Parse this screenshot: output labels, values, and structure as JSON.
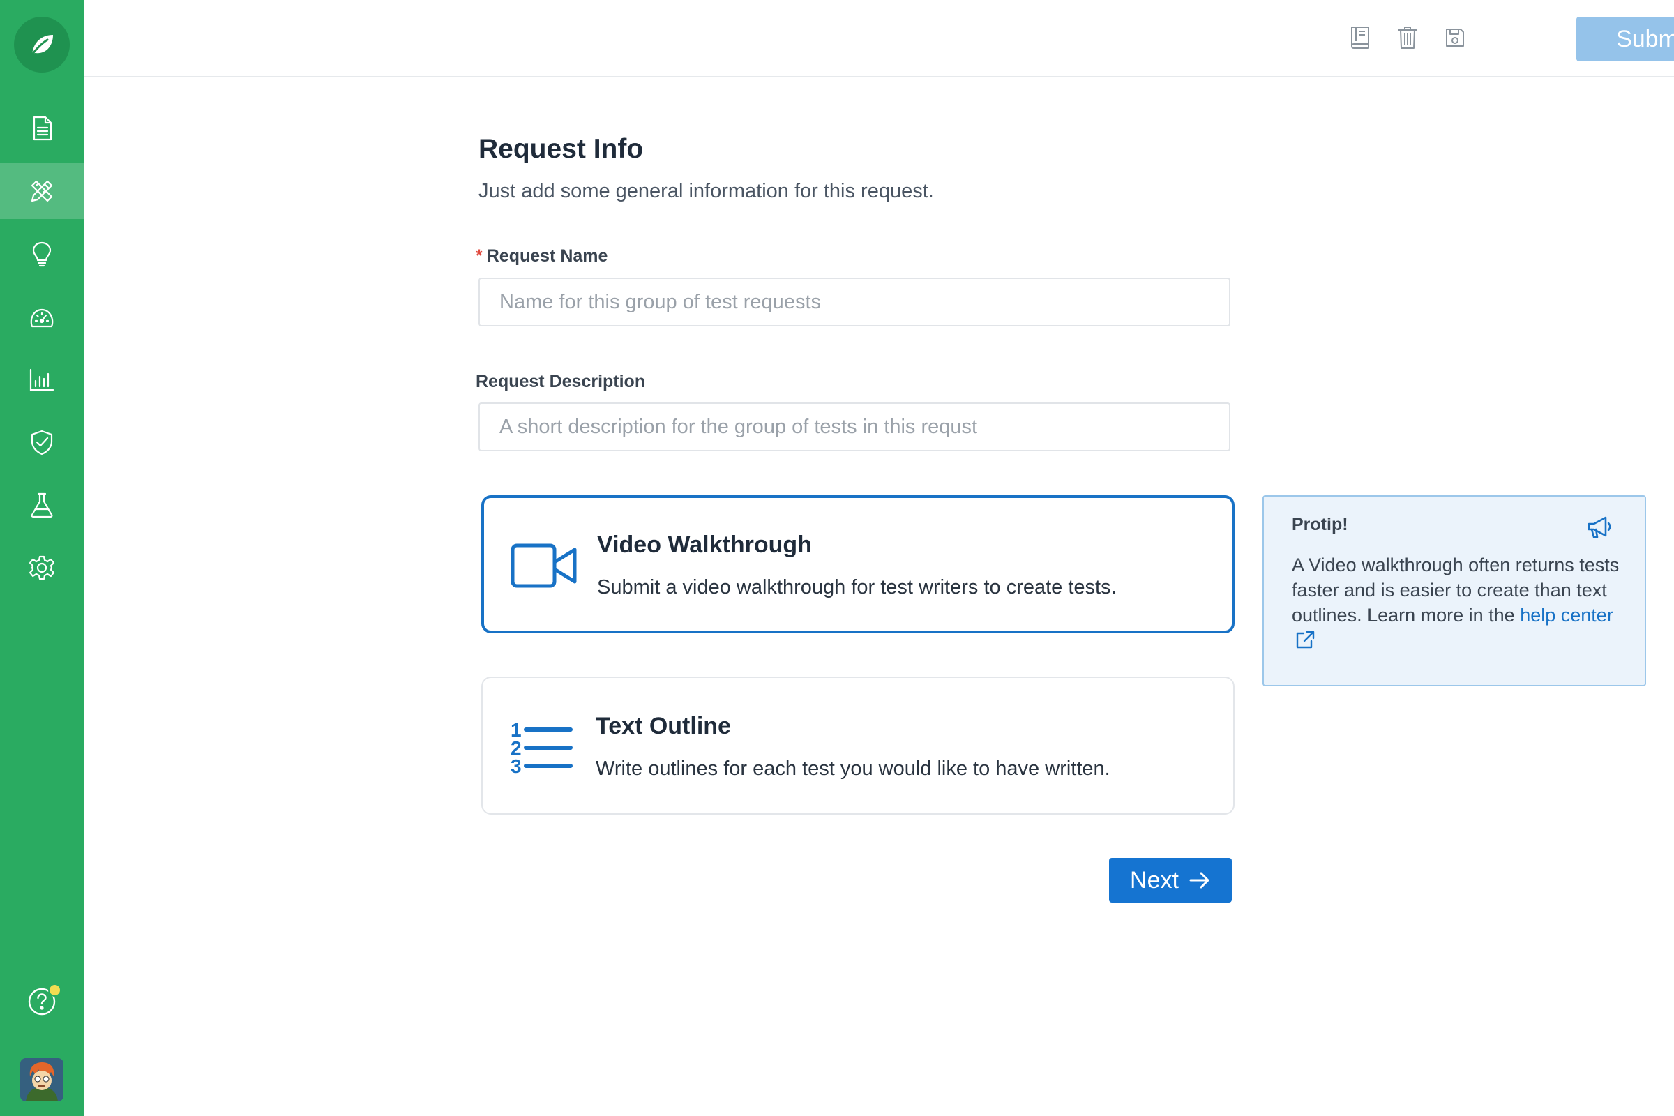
{
  "colors": {
    "sidebar": "#2aab61",
    "accent": "#1574d1",
    "submit_disabled": "#95c3ea",
    "protip_bg": "#ebf3fb"
  },
  "sidebar": {
    "logo_icon": "leaf-icon",
    "items": [
      {
        "icon": "document-icon",
        "active": false
      },
      {
        "icon": "pencil-ruler-icon",
        "active": true
      },
      {
        "icon": "lightbulb-icon",
        "active": false
      },
      {
        "icon": "speedometer-icon",
        "active": false
      },
      {
        "icon": "bar-chart-icon",
        "active": false
      },
      {
        "icon": "shield-check-icon",
        "active": false
      },
      {
        "icon": "flask-icon",
        "active": false
      },
      {
        "icon": "gear-icon",
        "active": false
      }
    ],
    "help_icon": "help-circle-icon"
  },
  "toolbar": {
    "icons": [
      "book-icon",
      "trash-icon",
      "save-icon"
    ],
    "submit_label": "Submit"
  },
  "form": {
    "title": "Request Info",
    "subtitle": "Just add some general information for this request.",
    "name_required_mark": "*",
    "name_label": "Request Name",
    "name_placeholder": "Name for this group of test requests",
    "name_value": "",
    "description_label": "Request Description",
    "description_placeholder": "A short description for the group of tests in this requst",
    "description_value": ""
  },
  "options": [
    {
      "title": "Video Walkthrough",
      "description": "Submit a video walkthrough for test writers to create tests.",
      "icon": "video-camera-icon",
      "selected": true
    },
    {
      "title": "Text Outline",
      "description": "Write outlines for each test you would like to have written.",
      "icon": "numbered-list-icon",
      "selected": false
    }
  ],
  "protip": {
    "title": "Protip!",
    "icon": "megaphone-icon",
    "text": "A Video walkthrough often returns tests faster and is easier to create than text outlines. Learn more in the",
    "link_label": "help center",
    "link_icon": "external-link-icon"
  },
  "next_label": "Next"
}
